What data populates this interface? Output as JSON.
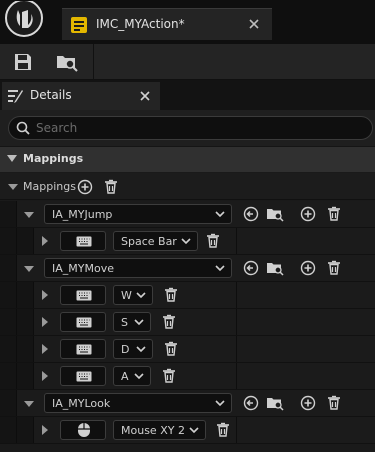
{
  "app": {
    "document_tab_title": "IMC_MYAction*"
  },
  "panel": {
    "tab_label": "Details"
  },
  "search": {
    "placeholder": "Search"
  },
  "category": {
    "label": "Mappings"
  },
  "mappings": {
    "label": "Mappings",
    "actions": [
      {
        "name": "IA_MYJump",
        "keys": [
          {
            "device": "keyboard-icon",
            "key": "Space Bar"
          }
        ]
      },
      {
        "name": "IA_MYMove",
        "keys": [
          {
            "device": "keyboard-icon",
            "key": "W"
          },
          {
            "device": "keyboard-icon",
            "key": "S"
          },
          {
            "device": "keyboard-icon",
            "key": "D"
          },
          {
            "device": "keyboard-icon",
            "key": "A"
          }
        ]
      },
      {
        "name": "IA_MYLook",
        "keys": [
          {
            "device": "mouse-icon",
            "key": "Mouse XY 2"
          }
        ]
      }
    ]
  },
  "colors": {
    "panel_bg": "#1b1b1b",
    "header_bg": "#303030",
    "field_bg": "#0f0f0f",
    "text": "#d0d0d0",
    "icon": "#cfcfcf"
  }
}
